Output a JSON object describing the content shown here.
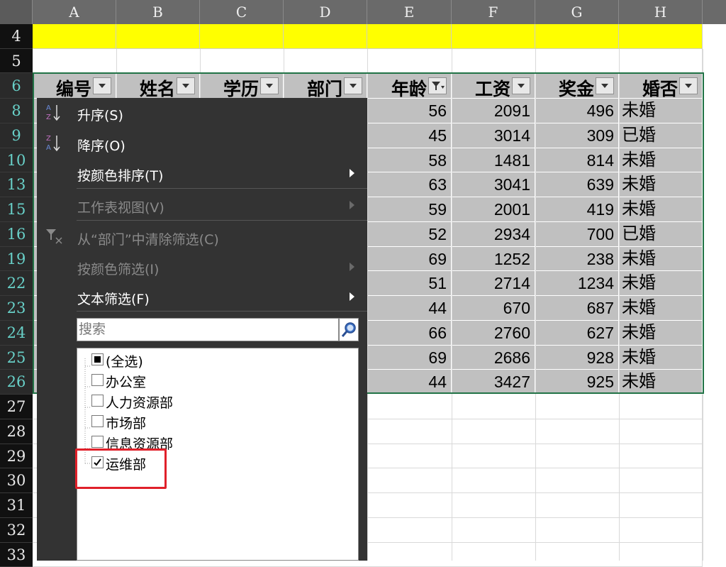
{
  "columns": [
    "A",
    "B",
    "C",
    "D",
    "E",
    "F",
    "G",
    "H"
  ],
  "header_row": {
    "row_label": "6",
    "cells": [
      "编号",
      "姓名",
      "学历",
      "部门",
      "年龄",
      "工资",
      "奖金",
      "婚否"
    ]
  },
  "top_rows": [
    "4",
    "5"
  ],
  "data_rows": [
    {
      "row": "8",
      "age": "56",
      "salary": "2091",
      "bonus": "496",
      "married": "未婚"
    },
    {
      "row": "9",
      "age": "45",
      "salary": "3014",
      "bonus": "309",
      "married": "已婚"
    },
    {
      "row": "10",
      "age": "58",
      "salary": "1481",
      "bonus": "814",
      "married": "未婚"
    },
    {
      "row": "13",
      "age": "63",
      "salary": "3041",
      "bonus": "639",
      "married": "未婚"
    },
    {
      "row": "15",
      "age": "59",
      "salary": "2001",
      "bonus": "419",
      "married": "未婚"
    },
    {
      "row": "16",
      "age": "52",
      "salary": "2934",
      "bonus": "700",
      "married": "已婚"
    },
    {
      "row": "19",
      "age": "69",
      "salary": "1252",
      "bonus": "238",
      "married": "未婚"
    },
    {
      "row": "22",
      "age": "51",
      "salary": "2714",
      "bonus": "1234",
      "married": "未婚"
    },
    {
      "row": "23",
      "age": "44",
      "salary": "670",
      "bonus": "687",
      "married": "未婚"
    },
    {
      "row": "24",
      "age": "66",
      "salary": "2760",
      "bonus": "627",
      "married": "未婚"
    },
    {
      "row": "25",
      "age": "69",
      "salary": "2686",
      "bonus": "928",
      "married": "未婚"
    },
    {
      "row": "26",
      "age": "44",
      "salary": "3427",
      "bonus": "925",
      "married": "未婚"
    }
  ],
  "empty_rows": [
    "27",
    "28",
    "29",
    "30",
    "31",
    "32",
    "33"
  ],
  "filter_menu": {
    "sort_asc": "升序(S)",
    "sort_desc": "降序(O)",
    "sort_by_color": "按颜色排序(T)",
    "sheet_view": "工作表视图(V)",
    "clear_filter": "从“部门”中清除筛选(C)",
    "filter_by_color": "按颜色筛选(I)",
    "text_filter": "文本筛选(F)",
    "search_placeholder": "搜索",
    "items": [
      {
        "label": "(全选)",
        "state": "partial"
      },
      {
        "label": "办公室",
        "state": "unchecked"
      },
      {
        "label": "人力资源部",
        "state": "unchecked"
      },
      {
        "label": "市场部",
        "state": "unchecked"
      },
      {
        "label": "信息资源部",
        "state": "unchecked"
      },
      {
        "label": "运维部",
        "state": "checked"
      }
    ]
  },
  "colors": {
    "header_fill": "#c0c0c0",
    "yellow": "#ffff00",
    "menu_bg": "#333333",
    "highlight": "#e0202a",
    "row_number_selected": "#68d0c8"
  }
}
